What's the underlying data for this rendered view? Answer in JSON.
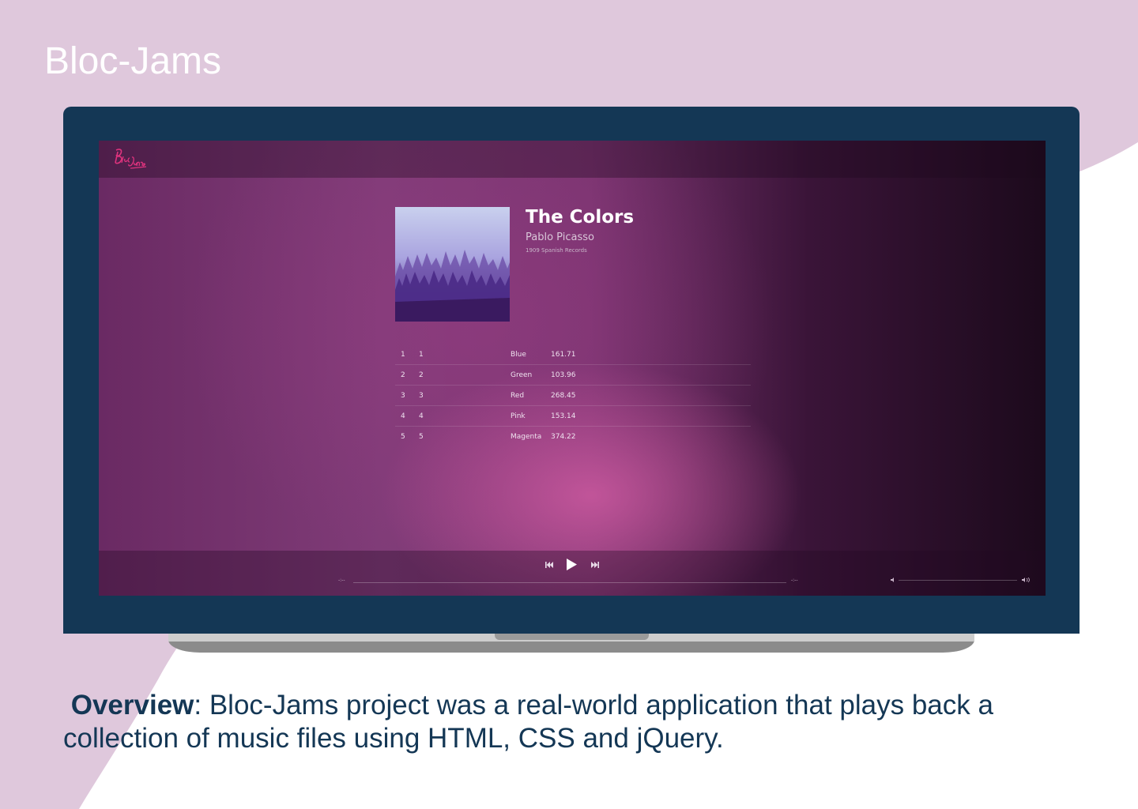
{
  "page": {
    "title": "Bloc-Jams",
    "overview_label": "Overview",
    "overview_text": ": Bloc-Jams project was a real-world application that plays back a collection of music files using HTML, CSS and jQuery."
  },
  "colors": {
    "background_pink": "#dfc8dc",
    "laptop_bezel": "#143755",
    "text_dark": "#143755"
  },
  "app": {
    "logo_icon": "bloc-jams-logo",
    "album": {
      "title": "The Colors",
      "artist": "Pablo Picasso",
      "release_info": "1909 Spanish Records"
    },
    "songs": [
      {
        "number": "1",
        "track": "1",
        "title": "Blue",
        "duration": "161.71"
      },
      {
        "number": "2",
        "track": "2",
        "title": "Green",
        "duration": "103.96"
      },
      {
        "number": "3",
        "track": "3",
        "title": "Red",
        "duration": "268.45"
      },
      {
        "number": "4",
        "track": "4",
        "title": "Pink",
        "duration": "153.14"
      },
      {
        "number": "5",
        "track": "5",
        "title": "Magenta",
        "duration": "374.22"
      }
    ],
    "player": {
      "current_time": "-:--",
      "total_time": "-:--",
      "volume_low_icon": "volume-low-icon",
      "volume_high_icon": "volume-high-icon",
      "previous_icon": "previous-icon",
      "play_icon": "play-icon",
      "next_icon": "next-icon"
    }
  }
}
